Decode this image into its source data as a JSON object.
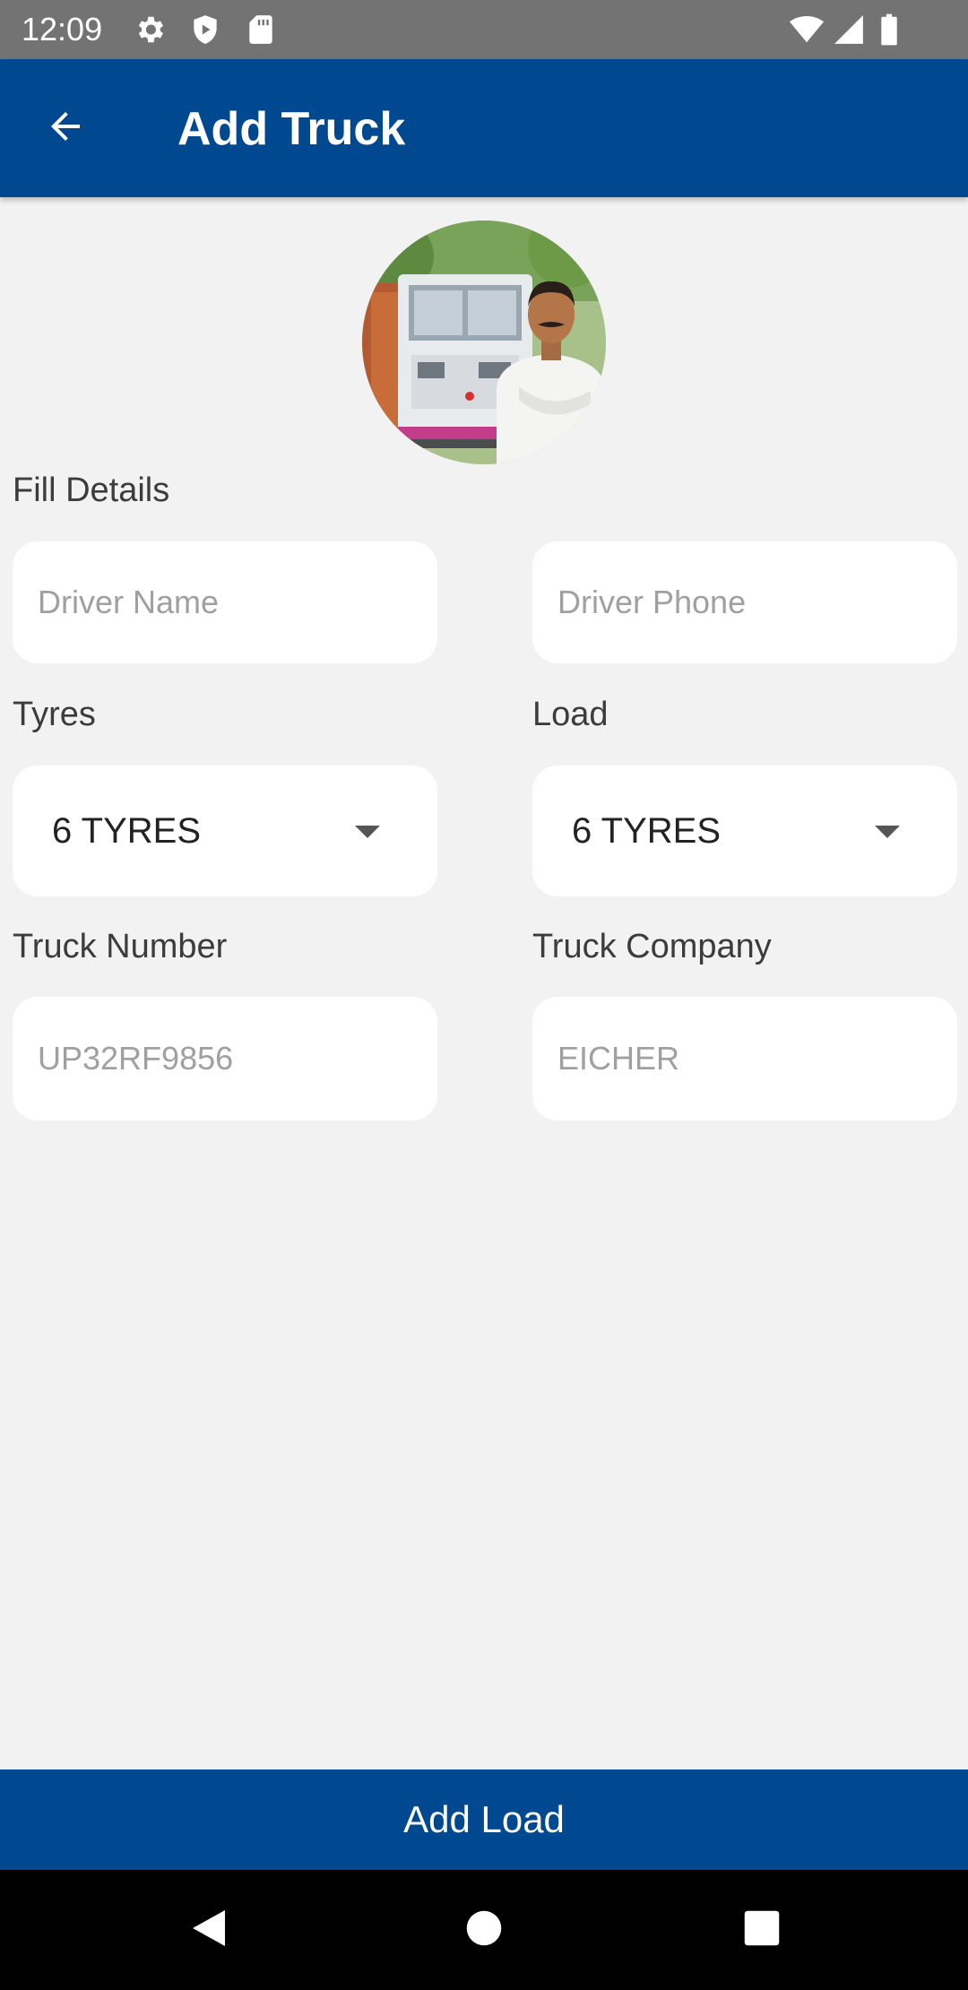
{
  "status_bar": {
    "time": "12:09",
    "icons": [
      "gear-icon",
      "shield-icon",
      "sd-card-icon",
      "wifi-icon",
      "signal-icon",
      "battery-icon"
    ]
  },
  "app_bar": {
    "title": "Add Truck",
    "back_icon": "arrow-left-icon",
    "color": "#004990"
  },
  "avatar": {
    "description_icon": "driver-with-truck-photo"
  },
  "form": {
    "section_label": "Fill Details",
    "driver_name": {
      "placeholder": "Driver Name",
      "value": ""
    },
    "driver_phone": {
      "placeholder": "Driver Phone",
      "value": ""
    },
    "tyres": {
      "label": "Tyres",
      "selected": "6 TYRES"
    },
    "load": {
      "label": "Load",
      "selected": "6 TYRES"
    },
    "truck_number": {
      "label": "Truck Number",
      "placeholder": "UP32RF9856",
      "value": ""
    },
    "truck_company": {
      "label": "Truck Company",
      "placeholder": "EICHER",
      "value": ""
    }
  },
  "footer": {
    "add_load_label": "Add Load"
  },
  "nav_bar": {
    "icons": [
      "back-triangle-icon",
      "home-circle-icon",
      "recents-square-icon"
    ]
  }
}
